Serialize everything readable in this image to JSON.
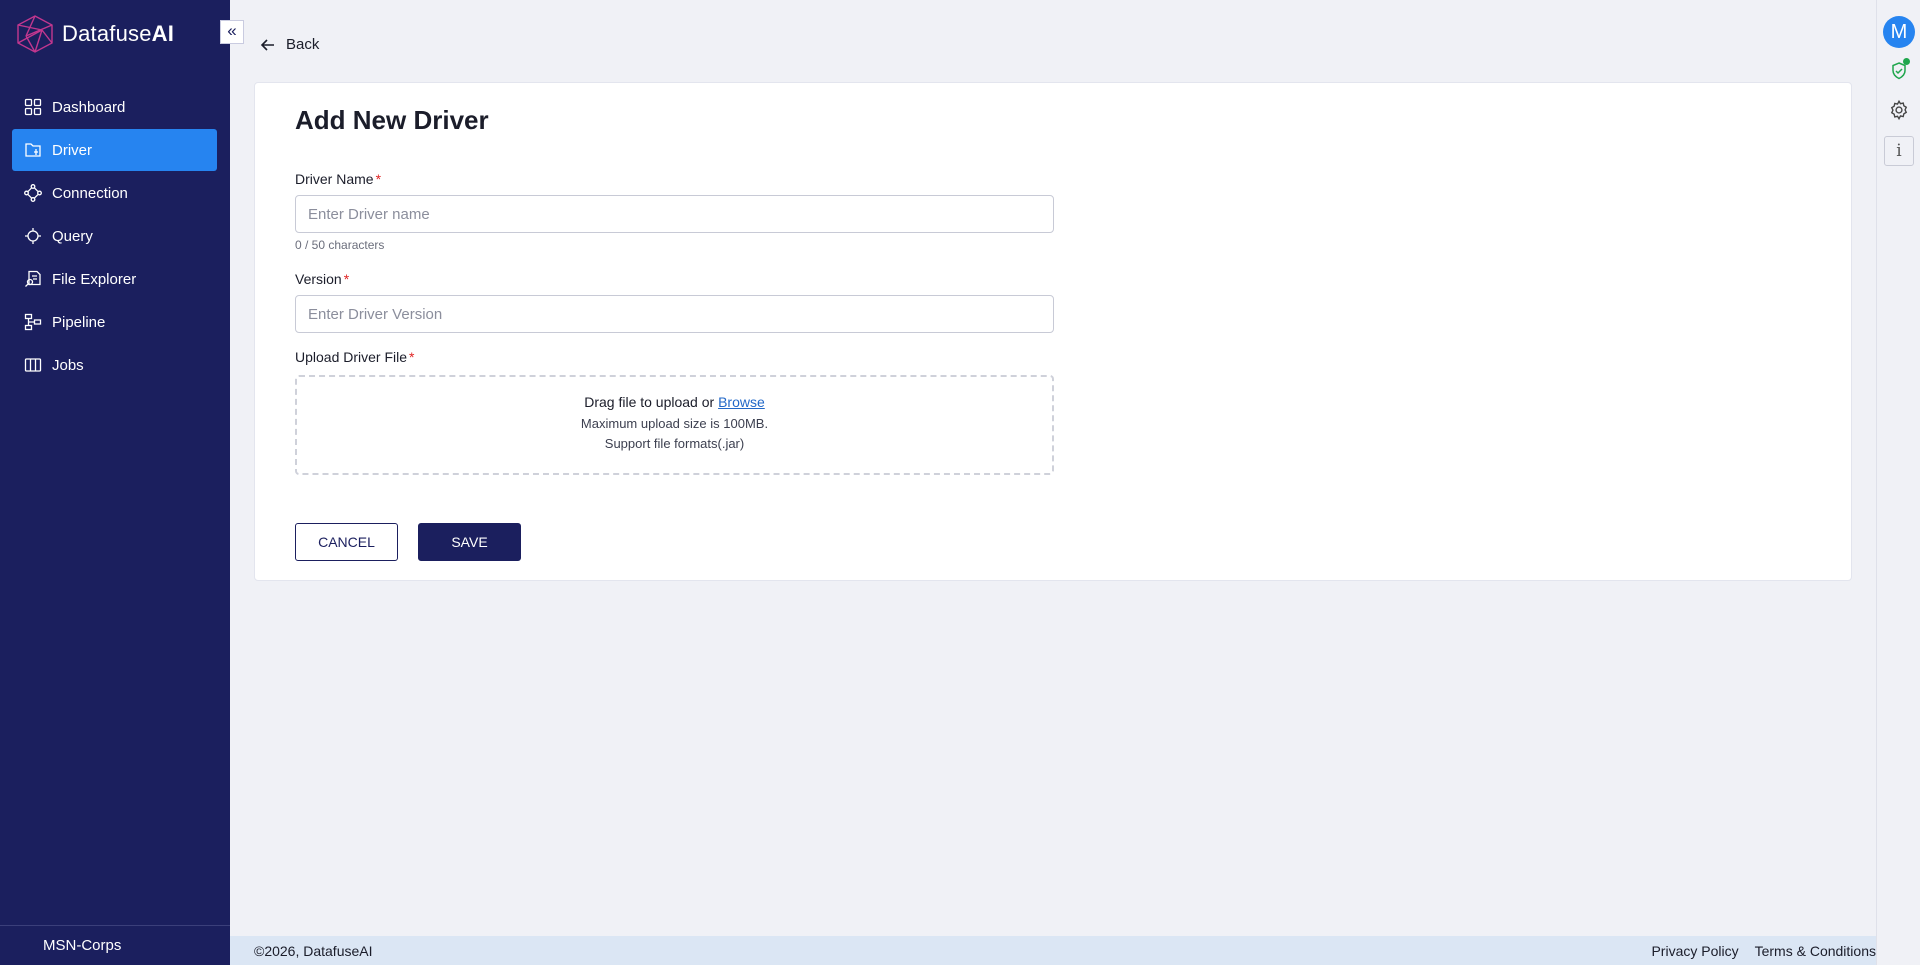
{
  "brand": {
    "name_regular": "Datafuse",
    "name_bold": "AI"
  },
  "sidebar": {
    "collapse_icon": "double-chevron-left-icon",
    "items": [
      {
        "label": "Dashboard",
        "icon": "dashboard-grid-icon",
        "active": false
      },
      {
        "label": "Driver",
        "icon": "driver-icon",
        "active": true
      },
      {
        "label": "Connection",
        "icon": "connection-icon",
        "active": false
      },
      {
        "label": "Query",
        "icon": "query-icon",
        "active": false
      },
      {
        "label": "File Explorer",
        "icon": "file-explorer-icon",
        "active": false
      },
      {
        "label": "Pipeline",
        "icon": "pipeline-icon",
        "active": false
      },
      {
        "label": "Jobs",
        "icon": "jobs-icon",
        "active": false
      }
    ],
    "org_name": "MSN-Corps"
  },
  "right_rail": {
    "avatar_initial": "M",
    "info_glyph": "i"
  },
  "page": {
    "back_label": "Back",
    "title": "Add New Driver",
    "form": {
      "driver_name_label": "Driver Name",
      "driver_name_placeholder": "Enter Driver name",
      "driver_name_value": "",
      "char_counter": "0 / 50 characters",
      "version_label": "Version",
      "version_placeholder": "Enter Driver Version",
      "version_value": "",
      "upload_label": "Upload Driver File",
      "required_mark": "*",
      "dropzone_text": "Drag file to upload or",
      "dropzone_link": "Browse",
      "dropzone_max_size": "Maximum upload size is 100MB.",
      "dropzone_formats": "Support file formats(.jar)"
    },
    "cancel_label": "CANCEL",
    "save_label": "SAVE"
  },
  "footer": {
    "copyright": "©2026, DatafuseAI",
    "privacy": "Privacy Policy",
    "terms": "Terms & Conditions"
  },
  "colors": {
    "sidebar_bg": "#1b1f5e",
    "active_item": "#2684f0",
    "primary_button": "#1b1f5e",
    "required": "#e02424",
    "link": "#2268c8",
    "footer_bg": "#dbe6f4"
  }
}
